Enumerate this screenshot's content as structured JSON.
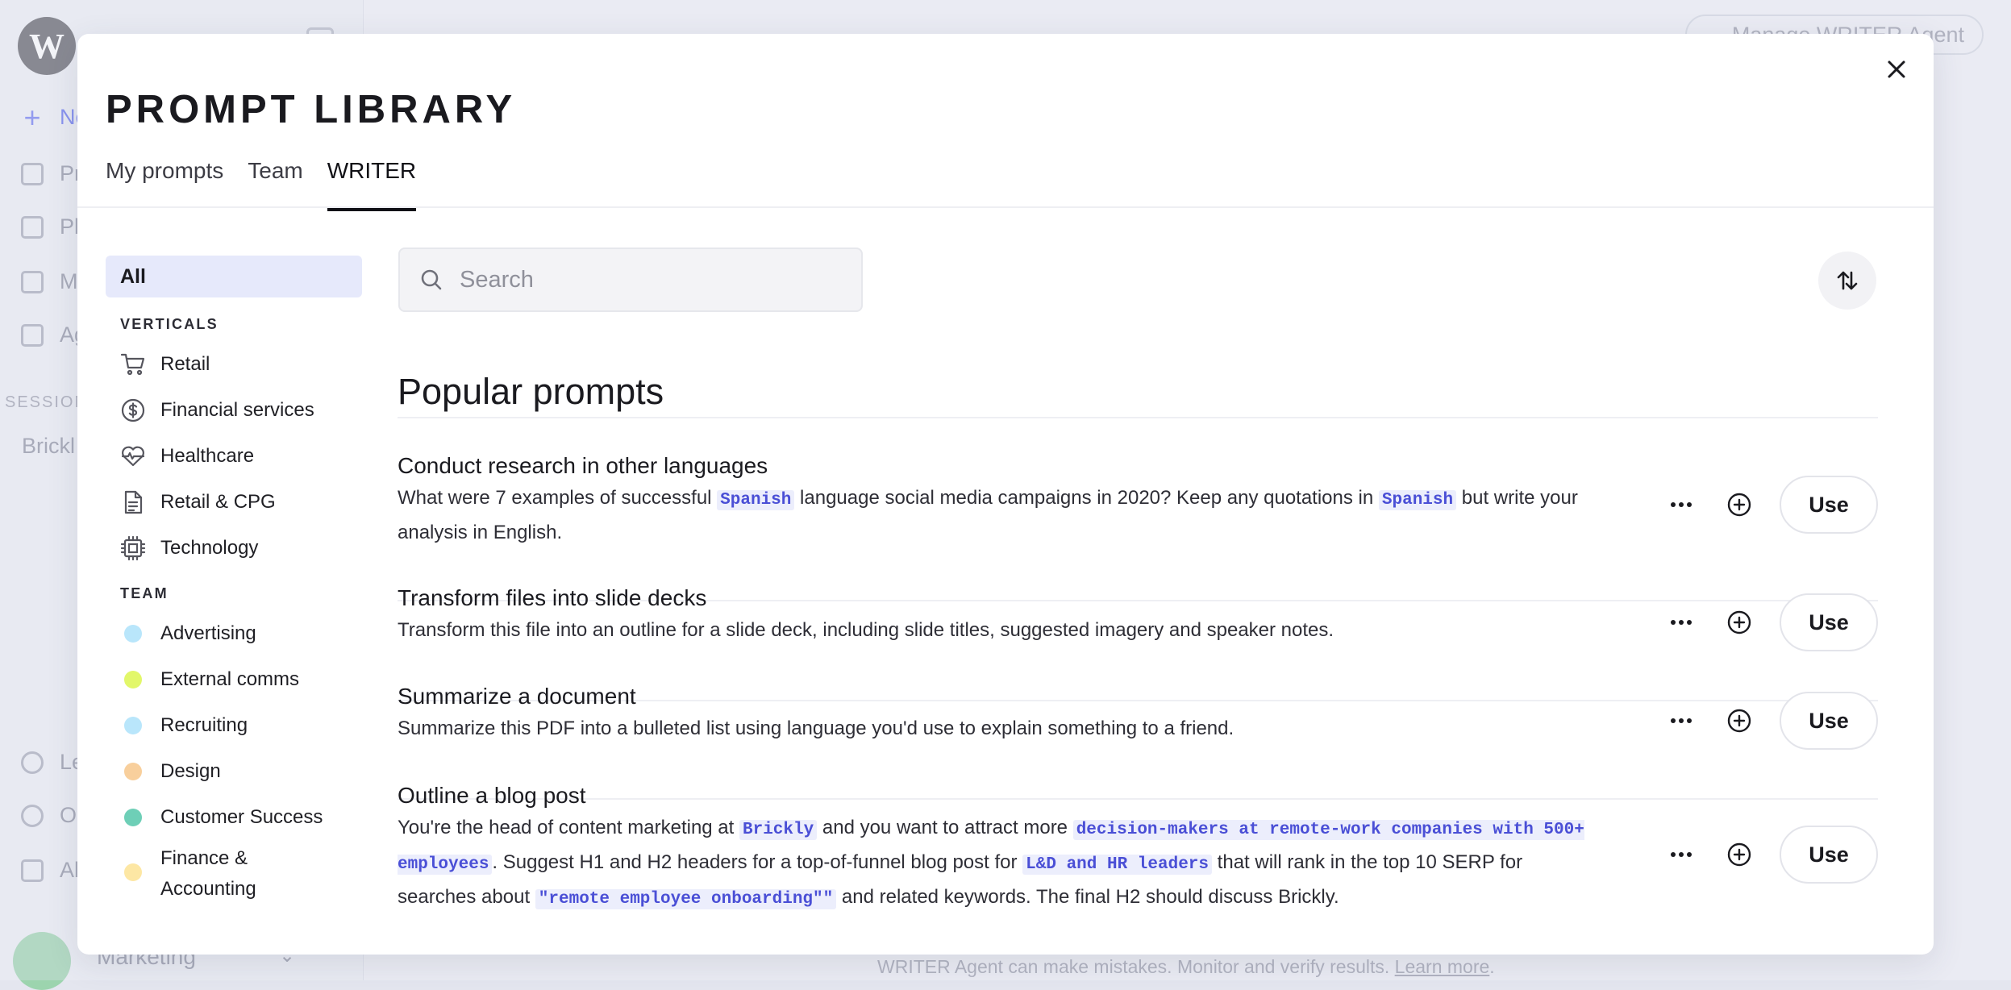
{
  "background": {
    "logo_letter": "W",
    "nav_items": [
      {
        "label": "Ne",
        "icon": "plus-icon"
      },
      {
        "label": "Pr",
        "icon": "folder-icon"
      },
      {
        "label": "Pl",
        "icon": "book-icon"
      },
      {
        "label": "M",
        "icon": "document-icon"
      },
      {
        "label": "Ag",
        "icon": "grid-icon"
      }
    ],
    "section_label": "SESSION",
    "session_item": "Brickl",
    "bottom_nav": [
      {
        "label": "Le",
        "icon": "lightbulb-icon"
      },
      {
        "label": "O",
        "icon": "gear-icon"
      },
      {
        "label": "Al",
        "icon": "tower-icon"
      }
    ],
    "workspace": "Marketing",
    "manage_button": "Manage WRITER Agent",
    "disclaimer": "WRITER Agent can make mistakes. Monitor and verify results.",
    "disclaimer_link": "Learn more"
  },
  "modal": {
    "title": "PROMPT LIBRARY",
    "tabs": [
      {
        "label": "My prompts",
        "active": false
      },
      {
        "label": "Team",
        "active": false
      },
      {
        "label": "WRITER",
        "active": true
      }
    ],
    "filters": {
      "all_label": "All",
      "verticals_heading": "VERTICALS",
      "verticals": [
        {
          "label": "Retail",
          "icon": "cart-icon"
        },
        {
          "label": "Financial services",
          "icon": "dollar-circle-icon"
        },
        {
          "label": "Healthcare",
          "icon": "heart-pulse-icon"
        },
        {
          "label": "Retail & CPG",
          "icon": "document-icon"
        },
        {
          "label": "Technology",
          "icon": "cpu-chip-icon"
        }
      ],
      "team_heading": "TEAM",
      "teams": [
        {
          "label": "Advertising",
          "color": "#b9e6fb"
        },
        {
          "label": "External comms",
          "color": "#e2f76a"
        },
        {
          "label": "Recruiting",
          "color": "#b9e6fb"
        },
        {
          "label": "Design",
          "color": "#f8cf9c"
        },
        {
          "label": "Customer Success",
          "color": "#6ecfb7"
        },
        {
          "label": "Finance & Accounting",
          "color": "#fde7a4"
        }
      ]
    },
    "search": {
      "placeholder": "Search",
      "value": ""
    },
    "section_title": "Popular prompts",
    "use_label": "Use",
    "prompts": [
      {
        "title": "Conduct research in other languages",
        "segments": [
          {
            "t": "What were 7 examples of successful "
          },
          {
            "t": "Spanish",
            "var": true
          },
          {
            "t": " language social media campaigns in 2020? Keep any quotations in "
          },
          {
            "t": "Spanish",
            "var": true
          },
          {
            "t": " but write your analysis in English."
          }
        ]
      },
      {
        "title": "Transform files into slide decks",
        "segments": [
          {
            "t": "Transform this file into an outline for a slide deck, including slide titles, suggested imagery and speaker notes."
          }
        ]
      },
      {
        "title": "Summarize a document",
        "segments": [
          {
            "t": "Summarize this PDF into a bulleted list using language you'd use to explain something to a friend."
          }
        ]
      },
      {
        "title": "Outline a blog post",
        "segments": [
          {
            "t": "You're the head of content marketing at "
          },
          {
            "t": "Brickly",
            "var": true
          },
          {
            "t": " and you want to attract more "
          },
          {
            "t": "decision-makers at remote-work companies with 500+ employees",
            "var": true
          },
          {
            "t": ". Suggest H1 and H2 headers for a top-of-funnel blog post for "
          },
          {
            "t": "L&D and HR leaders",
            "var": true
          },
          {
            "t": " that will rank in the top 10 SERP for searches about "
          },
          {
            "t": "\"remote employee onboarding\"\"",
            "var": true
          },
          {
            "t": " and related keywords. The final H2 should discuss Brickly."
          }
        ]
      }
    ]
  }
}
